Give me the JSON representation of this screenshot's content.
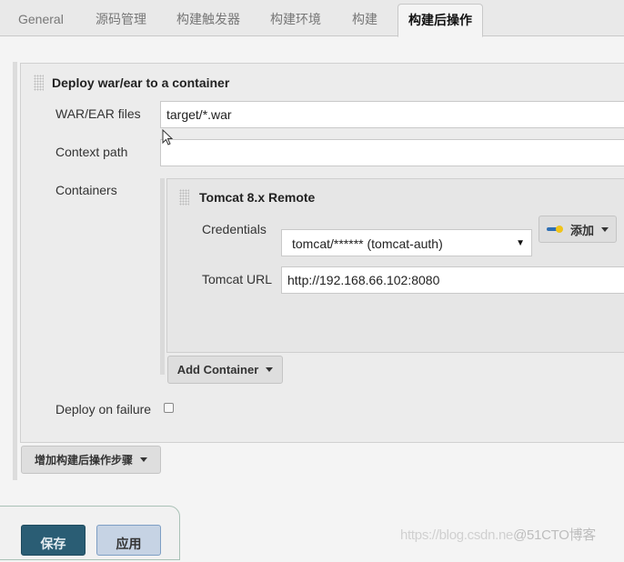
{
  "tabs": [
    {
      "label": "General",
      "active": false
    },
    {
      "label": "源码管理",
      "active": false
    },
    {
      "label": "构建触发器",
      "active": false
    },
    {
      "label": "构建环境",
      "active": false
    },
    {
      "label": "构建",
      "active": false
    },
    {
      "label": "构建后操作",
      "active": true
    }
  ],
  "deploy": {
    "title": "Deploy war/ear to a container",
    "war_files_label": "WAR/EAR files",
    "war_files_value": "target/*.war",
    "context_path_label": "Context path",
    "context_path_value": "",
    "containers_label": "Containers",
    "deploy_on_failure_label": "Deploy on failure",
    "deploy_on_failure_checked": false
  },
  "tomcat": {
    "title": "Tomcat 8.x Remote",
    "credentials_label": "Credentials",
    "credentials_value": "tomcat/****** (tomcat-auth)",
    "add_button_label": "添加",
    "url_label": "Tomcat URL",
    "url_value": "http://192.168.66.102:8080"
  },
  "buttons": {
    "add_container": "Add Container",
    "add_post_build_step": "增加构建后操作步骤",
    "save": "保存",
    "apply": "应用"
  },
  "watermark": {
    "url": "https://blog.csdn.ne",
    "brand": "@51CTO博客"
  }
}
